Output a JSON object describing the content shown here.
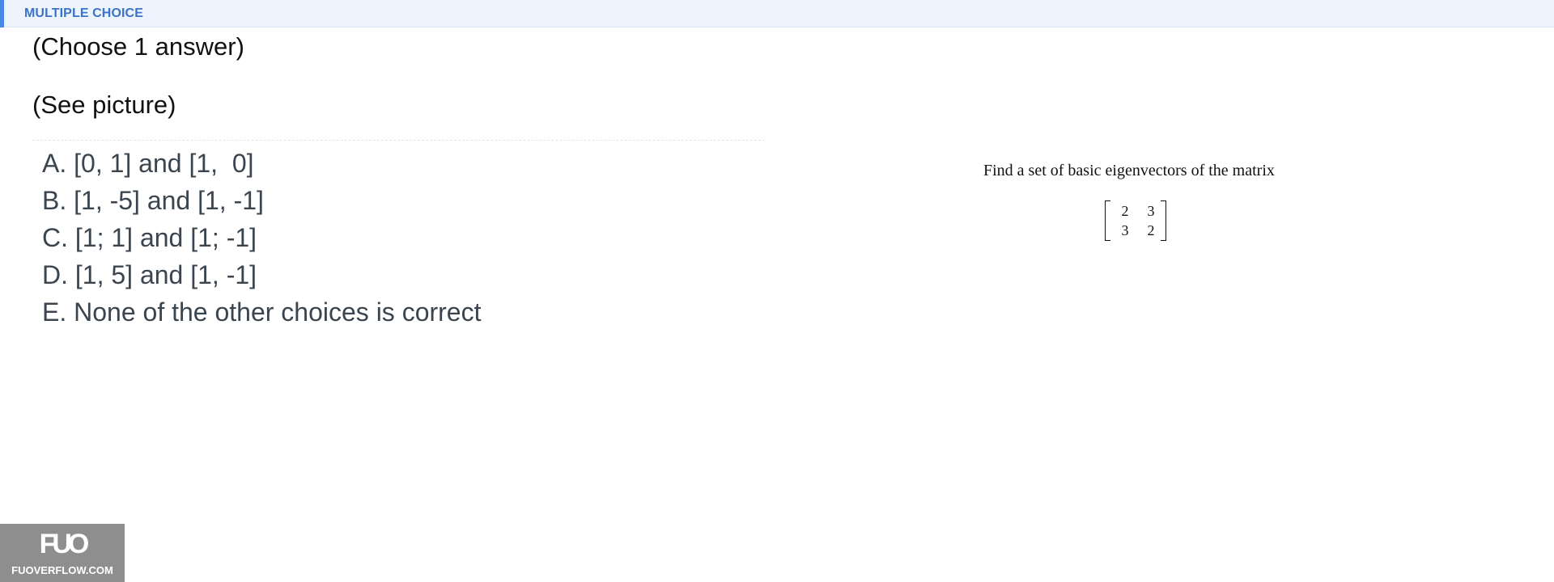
{
  "header": {
    "title": "MULTIPLE CHOICE",
    "accent_color": "#4a86e8",
    "background_color": "#eef4fd"
  },
  "question": {
    "instruction": "(Choose 1 answer)",
    "reference": "(See picture)"
  },
  "options": [
    "A. [0, 1] and [1,  0]",
    "B. [1, -5] and [1, -1]",
    "C. [1; 1] and [1; -1]",
    "D. [1, 5] and [1, -1]",
    "E. None of the other choices is correct"
  ],
  "problem_image": {
    "text": "Find a set of basic eigenvectors of the matrix",
    "matrix": [
      [
        "2",
        "3"
      ],
      [
        "3",
        "2"
      ]
    ]
  },
  "watermark": {
    "logo": "FUO",
    "site": "FUOVERFLOW.COM"
  }
}
